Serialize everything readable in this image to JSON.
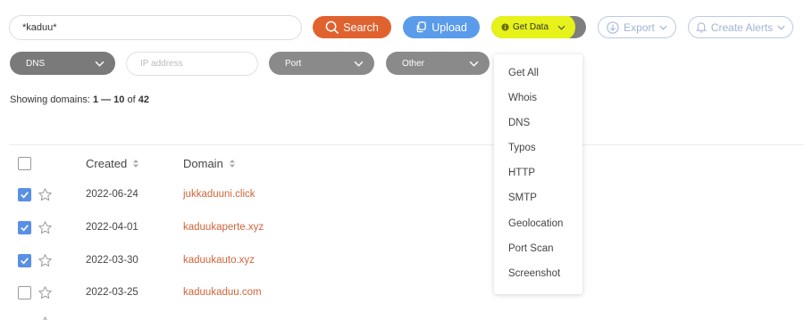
{
  "search": {
    "value": "*kaduu*"
  },
  "toolbar": {
    "search_label": "Search",
    "upload_label": "Upload",
    "get_data_label": "Get Data",
    "export_label": "Export",
    "create_alerts_label": "Create Alerts"
  },
  "filters": {
    "dns_label": "DNS",
    "ip_placeholder": "IP address",
    "port_label": "Port",
    "other_label": "Other"
  },
  "showing": {
    "prefix": "Showing domains: ",
    "range": "1 — 10",
    "of": " of ",
    "total": "42"
  },
  "table": {
    "columns": {
      "created": "Created",
      "domain": "Domain"
    },
    "rows": [
      {
        "created": "2022-06-24",
        "domain": "jukkaduuni.click",
        "checked": true
      },
      {
        "created": "2022-04-01",
        "domain": "kaduukaperte.xyz",
        "checked": true
      },
      {
        "created": "2022-03-30",
        "domain": "kaduukauto.xyz",
        "checked": true
      },
      {
        "created": "2022-03-25",
        "domain": "kaduukaduu.com",
        "checked": false
      }
    ]
  },
  "get_data_menu": {
    "items": [
      "Get All",
      "Whois",
      "DNS",
      "Typos",
      "HTTP",
      "SMTP",
      "Geolocation",
      "Port Scan",
      "Screenshot"
    ]
  },
  "colors": {
    "search_button": "#e0622f",
    "upload_button": "#5a9bea",
    "get_data_highlight": "#e6f21a",
    "domain_link": "#d0643a",
    "checkbox_checked": "#5a8fe6"
  }
}
